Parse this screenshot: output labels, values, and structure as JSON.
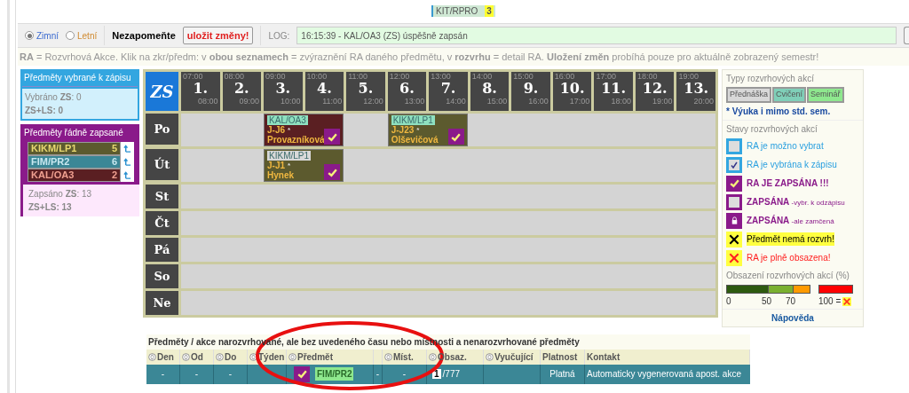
{
  "top_chip": {
    "code": "KIT/RPRO",
    "count": "3"
  },
  "toolbar": {
    "semesters": [
      {
        "label": "Zimní",
        "selected": true
      },
      {
        "label": "Letní",
        "selected": false
      }
    ],
    "reminder": "Nezapomeňte",
    "save_button": "uložit změny!",
    "log_label": "LOG:",
    "log_value": "16:15:39 - KAL/OA3 (ZS) úspěšně zapsán"
  },
  "info": "**RA** = Rozvrhová Akce. Klik na zkr/předm: v **obou seznamech** = zvýraznění RA daného předmětu, v **rozvrhu** = detail RA. **Uložení změn** probíhá pouze pro aktuálně zobrazený semestr!",
  "selected_panel": {
    "title": "Předměty vybrané k zápisu",
    "lines": [
      "Vybráno **ZS**: 0",
      "**ZS**+**LS**: 0"
    ]
  },
  "enrolled_panel": {
    "title": "Předměty řádně zapsané",
    "subjects": [
      {
        "code": "KIKM/LP1",
        "count": "5",
        "color": "#5c5a2e"
      },
      {
        "code": "FIM/PR2",
        "count": "6",
        "color": "#3b8796"
      },
      {
        "code": "KAL/OA3",
        "count": "2",
        "color": "#5a1f22"
      }
    ],
    "lines": [
      "Zapsáno **ZS**: 13",
      "**ZS**+**LS**: 13"
    ]
  },
  "schedule": {
    "semester": "ZS",
    "periods": [
      {
        "start": "07:00",
        "number": "1.",
        "end": "08:00"
      },
      {
        "start": "08:00",
        "number": "2.",
        "end": "09:00"
      },
      {
        "start": "09:00",
        "number": "3.",
        "end": "10:00"
      },
      {
        "start": "10:00",
        "number": "4.",
        "end": "11:00"
      },
      {
        "start": "11:00",
        "number": "5.",
        "end": "12:00"
      },
      {
        "start": "12:00",
        "number": "6.",
        "end": "13:00"
      },
      {
        "start": "13:00",
        "number": "7.",
        "end": "14:00"
      },
      {
        "start": "14:00",
        "number": "8.",
        "end": "15:00"
      },
      {
        "start": "15:00",
        "number": "9.",
        "end": "16:00"
      },
      {
        "start": "16:00",
        "number": "10.",
        "end": "17:00"
      },
      {
        "start": "17:00",
        "number": "11.",
        "end": "18:00"
      },
      {
        "start": "18:00",
        "number": "12.",
        "end": "19:00"
      },
      {
        "start": "19:00",
        "number": "13.",
        "end": "20:00"
      }
    ],
    "days": [
      {
        "label": "Po",
        "cells": [
          {
            "kind": "empty"
          },
          {
            "kind": "empty"
          },
          {
            "kind": "event",
            "tag": {
              "code": "KAL/OA3",
              "color": "#8fe0c0"
            },
            "room": "J-J6",
            "mark": "*",
            "teacher": "Provazníková",
            "color": "#5a1f22",
            "enrolled": true
          },
          {
            "kind": "empty"
          },
          {
            "kind": "event",
            "tag": {
              "code": "KIKM/LP1",
              "color": "#8fe0c0"
            },
            "room": "J-J23",
            "mark": "*",
            "teacher": "Olševičová",
            "color": "#5c5a2e",
            "enrolled": true
          }
        ]
      },
      {
        "label": "Út",
        "cells": [
          {
            "kind": "empty"
          },
          {
            "kind": "empty"
          },
          {
            "kind": "event",
            "tag": {
              "code": "KIKM/LP1",
              "color": "#d8d8d8"
            },
            "room": "J-J1",
            "mark": "*",
            "teacher": "Hynek",
            "color": "#5c5a2e",
            "enrolled": true
          }
        ]
      },
      {
        "label": "St"
      },
      {
        "label": "Čt"
      },
      {
        "label": "Pá"
      },
      {
        "label": "So"
      },
      {
        "label": "Ne"
      }
    ]
  },
  "legend": {
    "types_title": "Typy rozvrhových akcí",
    "types": [
      {
        "label": "Přednáška",
        "color": "#d8d8d8"
      },
      {
        "label": "Cvičení",
        "color": "#7fcfb8"
      },
      {
        "label": "Seminář",
        "color": "#8ee88e"
      }
    ],
    "note": "* Výuka i mimo std. sem.",
    "states_title": "Stavy rozvrhových akcí",
    "states": [
      {
        "kind": "blue-empty",
        "label": "RA je možno vybrat"
      },
      {
        "kind": "blue-checked",
        "label": "RA je vybrána k zápisu"
      },
      {
        "kind": "purple-checked",
        "label": "RA JE ZAPSÁNA !!!"
      },
      {
        "kind": "purple-empty",
        "label": "ZAPSÁNA",
        "suffix": "-vybr. k odzápisu"
      },
      {
        "kind": "purple-locked",
        "label": "ZAPSÁNA",
        "suffix": "-ale zamčená"
      },
      {
        "kind": "no-schedule",
        "label": "Předmět nemá rozvrh!"
      },
      {
        "kind": "full",
        "label": "RA je plně obsazena!"
      }
    ],
    "occupancy_title": "Obsazení rozvrhových akcí (%)",
    "scale": [
      "0",
      "50",
      "70",
      "100 ="
    ],
    "help": "Nápověda"
  },
  "table": {
    "title": "Předměty / akce narozvrhované, ale bez uvedeného času nebo místnosti a nenarozvrhované předměty",
    "columns": [
      {
        "label": "Den",
        "sortable": true
      },
      {
        "label": "Od",
        "sortable": true
      },
      {
        "label": "Do",
        "sortable": true
      },
      {
        "label": "Týden",
        "sortable": true
      },
      {
        "label": "Předmět",
        "sortable": true
      },
      {
        "sortable": false
      },
      {
        "label": "Míst.",
        "sortable": true
      },
      {
        "label": "Obsaz.",
        "sortable": true
      },
      {
        "label": "Vyučující",
        "sortable": true
      },
      {
        "label": "Platnost",
        "sortable": false
      },
      {
        "label": "Kontakt",
        "sortable": false
      }
    ],
    "rows": [
      {
        "day": "-",
        "from": "-",
        "to": "-",
        "subject": {
          "code": "FIM/PR2",
          "enrolled": true
        },
        "column_6": "-",
        "room": "-",
        "occupancy": {
          "value": "1",
          "capacity": "/777"
        },
        "validity": "Platná",
        "contact": "Automaticky vygenerovaná apost. akce"
      }
    ]
  }
}
